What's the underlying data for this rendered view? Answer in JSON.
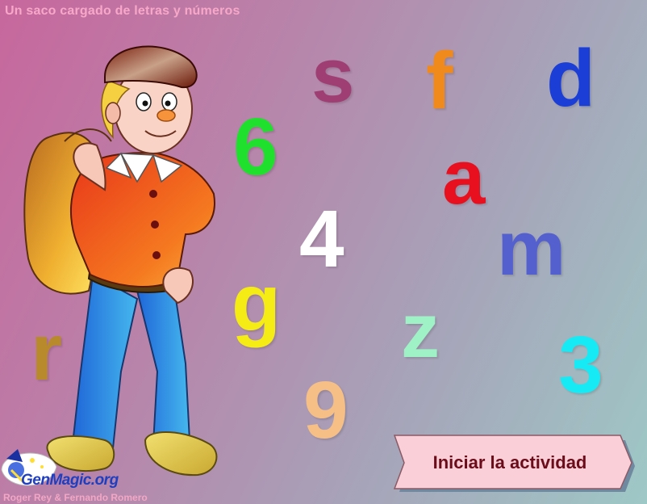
{
  "app": {
    "title": "Un saco cargado de letras y números"
  },
  "glyphs": [
    {
      "id": "s",
      "char": "s",
      "color": "#9e3e72"
    },
    {
      "id": "f",
      "char": "f",
      "color": "#f08a1c"
    },
    {
      "id": "d",
      "char": "d",
      "color": "#1a3ed6"
    },
    {
      "id": "6",
      "char": "6",
      "color": "#1fe02c"
    },
    {
      "id": "a",
      "char": "a",
      "color": "#e8101e"
    },
    {
      "id": "4",
      "char": "4",
      "color": "#ffffff"
    },
    {
      "id": "m",
      "char": "m",
      "color": "#5560cf"
    },
    {
      "id": "g",
      "char": "g",
      "color": "#f4ec14"
    },
    {
      "id": "z",
      "char": "z",
      "color": "#9ff2c6"
    },
    {
      "id": "r",
      "char": "r",
      "color": "#b98a2b"
    },
    {
      "id": "3",
      "char": "3",
      "color": "#16eaf4"
    },
    {
      "id": "9",
      "char": "9",
      "color": "#f6bf86"
    }
  ],
  "logo": {
    "name": "GenMagic.org"
  },
  "credits": "Roger Rey  &  Fernando Romero",
  "start_button": {
    "label": "Iniciar la actividad"
  },
  "colors": {
    "title": "#f7a8c8",
    "button_fill": "#fbcfd7",
    "button_text": "#6b0c1a"
  }
}
